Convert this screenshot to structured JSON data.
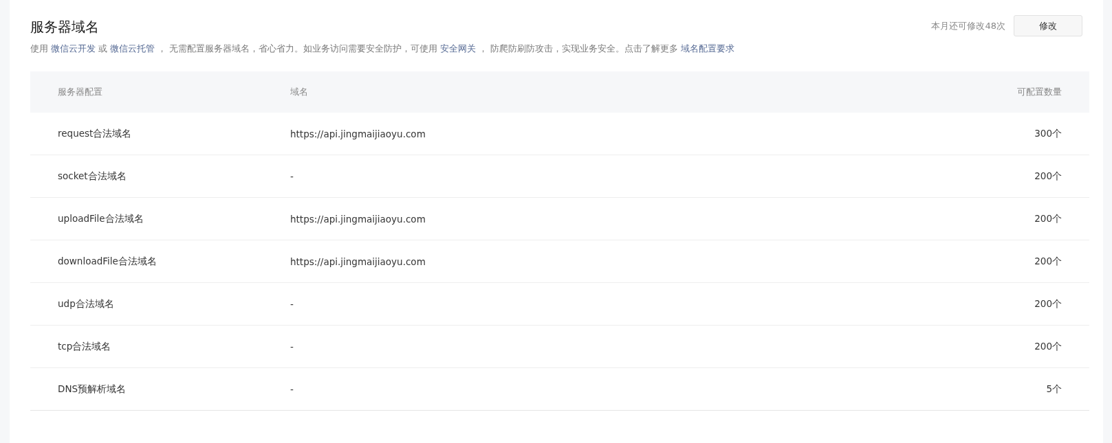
{
  "title": "服务器域名",
  "description": [
    {
      "text": "使用 ",
      "link": false
    },
    {
      "text": "微信云开发",
      "link": true
    },
    {
      "text": " 或 ",
      "link": false
    },
    {
      "text": "微信云托管",
      "link": true
    },
    {
      "text": " ， 无需配置服务器域名，省心省力。如业务访问需要安全防护，可使用 ",
      "link": false
    },
    {
      "text": "安全网关",
      "link": true
    },
    {
      "text": " ， 防爬防刷防攻击，实现业务安全。点击了解更多 ",
      "link": false
    },
    {
      "text": "域名配置要求",
      "link": true
    }
  ],
  "remaining": "本月还可修改48次",
  "edit_button": "修改",
  "table": {
    "columns": [
      "服务器配置",
      "域名",
      "可配置数量"
    ],
    "rows": [
      [
        "request合法域名",
        "https://api.jingmaijiaoyu.com",
        "300个"
      ],
      [
        "socket合法域名",
        "-",
        "200个"
      ],
      [
        "uploadFile合法域名",
        "https://api.jingmaijiaoyu.com",
        "200个"
      ],
      [
        "downloadFile合法域名",
        "https://api.jingmaijiaoyu.com",
        "200个"
      ],
      [
        "udp合法域名",
        "-",
        "200个"
      ],
      [
        "tcp合法域名",
        "-",
        "200个"
      ],
      [
        "DNS预解析域名",
        "-",
        "5个"
      ]
    ]
  }
}
